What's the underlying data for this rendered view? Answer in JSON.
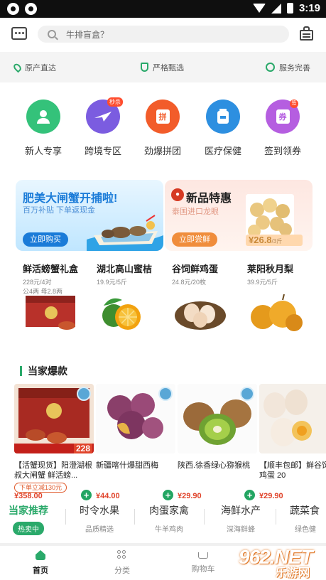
{
  "status_bar": {
    "time": "3:19"
  },
  "header": {
    "search_placeholder": "牛排盲盒？"
  },
  "features": [
    "原产直达",
    "严格甄选",
    "服务完善"
  ],
  "categories": [
    {
      "label": "新人专享",
      "color": "#34c27a",
      "icon": "person-icon"
    },
    {
      "label": "跨境专区",
      "color": "#7b5ce0",
      "icon": "plane-icon",
      "badge": "秒杀"
    },
    {
      "label": "劲爆拼团",
      "color": "#f25c2a",
      "icon": "bag-icon",
      "glyph": "拼"
    },
    {
      "label": "医疗保健",
      "color": "#2d8fe0",
      "icon": "medicine-icon"
    },
    {
      "label": "签到领券",
      "color": "#b55ee0",
      "icon": "coupon-icon",
      "glyph": "券",
      "badge": "签"
    }
  ],
  "banners": {
    "left": {
      "title": "肥美大闸蟹开捕啦!",
      "subtitle": "百万补贴 下单返现金",
      "button": "立即购买"
    },
    "right": {
      "title": "新品特惠",
      "subtitle": "泰国进口龙眼",
      "button": "立即尝鲜",
      "price": "¥26.8",
      "price_unit": "/3斤"
    }
  },
  "featured": [
    {
      "name": "鲜活螃蟹礼盒",
      "price": "228元/4对",
      "spec": "公4两 母2.8两"
    },
    {
      "name": "湖北高山蜜桔",
      "price": "19.9元/5斤"
    },
    {
      "name": "谷饲鲜鸡蛋",
      "price": "24.8元/20枚"
    },
    {
      "name": "莱阳秋月梨",
      "price": "39.9元/5斤"
    }
  ],
  "section": {
    "title": "当家爆款"
  },
  "products": [
    {
      "name": "【活蟹现货】阳澄湖根叔大闸蟹 鲜活螃...",
      "tag": "下单立减130元",
      "price": "¥358.00",
      "img_price": "228"
    },
    {
      "name": "新疆喀什爆甜西梅",
      "price": "¥44.00"
    },
    {
      "name": "陕西.徐香绿心猕猴桃",
      "price": "¥29.90"
    },
    {
      "name": "【顺丰包邮】鲜谷饲鲜鸡蛋 20",
      "price": "¥29.90"
    }
  ],
  "tabs": [
    {
      "title": "当家推荐",
      "sub": "热卖中",
      "active": true
    },
    {
      "title": "时令水果",
      "sub": "品质精选"
    },
    {
      "title": "肉蛋家禽",
      "sub": "牛羊鸡肉"
    },
    {
      "title": "海鲜水产",
      "sub": "深海鲜蜂"
    },
    {
      "title": "蔬菜食",
      "sub": "绿色健"
    }
  ],
  "nav": [
    {
      "label": "首页",
      "active": true
    },
    {
      "label": "分类"
    },
    {
      "label": "购物车"
    }
  ],
  "watermark": {
    "big": "962.NET",
    "small": "乐游网"
  },
  "colors": {
    "accent": "#2aa96a",
    "price": "#e0432a"
  }
}
